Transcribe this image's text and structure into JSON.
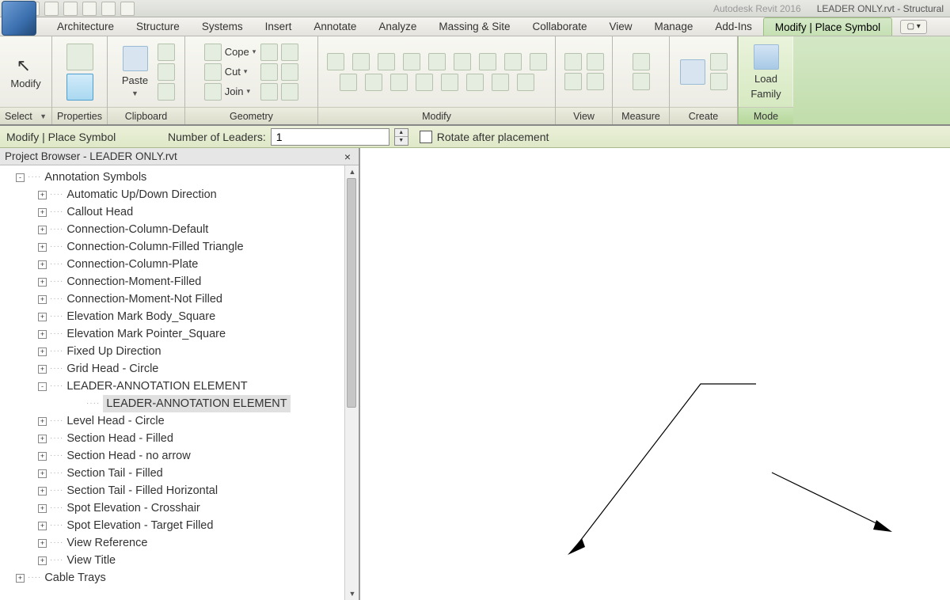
{
  "app": {
    "product": "Autodesk Revit 2016",
    "doc_title": "LEADER ONLY.rvt - Structural"
  },
  "tabs": {
    "items": [
      "Architecture",
      "Structure",
      "Systems",
      "Insert",
      "Annotate",
      "Analyze",
      "Massing & Site",
      "Collaborate",
      "View",
      "Manage",
      "Add-Ins",
      "Modify | Place Symbol"
    ],
    "active_index": 11
  },
  "ribbon": {
    "select_label": "Select",
    "modify_btn": "Modify",
    "properties_label": "Properties",
    "clipboard_label": "Clipboard",
    "paste_btn": "Paste",
    "geometry_label": "Geometry",
    "cope_btn": "Cope",
    "cut_btn": "Cut",
    "join_btn": "Join",
    "modify_label": "Modify",
    "view_label": "View",
    "measure_label": "Measure",
    "create_label": "Create",
    "mode_label": "Mode",
    "load_family_1": "Load",
    "load_family_2": "Family"
  },
  "options": {
    "state_label": "Modify | Place Symbol",
    "leaders_label": "Number of Leaders:",
    "leaders_value": "1",
    "rotate_label": "Rotate after placement"
  },
  "browser": {
    "title": "Project Browser - LEADER ONLY.rvt",
    "root": "Annotation Symbols",
    "items": [
      "Automatic Up/Down Direction",
      "Callout Head",
      "Connection-Column-Default",
      "Connection-Column-Filled Triangle",
      "Connection-Column-Plate",
      "Connection-Moment-Filled",
      "Connection-Moment-Not Filled",
      "Elevation Mark Body_Square",
      "Elevation Mark Pointer_Square",
      "Fixed Up Direction",
      "Grid Head - Circle",
      "LEADER-ANNOTATION ELEMENT",
      "Level Head - Circle",
      "Section Head - Filled",
      "Section Head - no arrow",
      "Section Tail - Filled",
      "Section Tail - Filled Horizontal",
      "Spot Elevation - Crosshair",
      "Spot Elevation - Target Filled",
      "View Reference",
      "View Title"
    ],
    "child_of_leader": "LEADER-ANNOTATION ELEMENT",
    "sibling_after": "Cable Trays"
  }
}
